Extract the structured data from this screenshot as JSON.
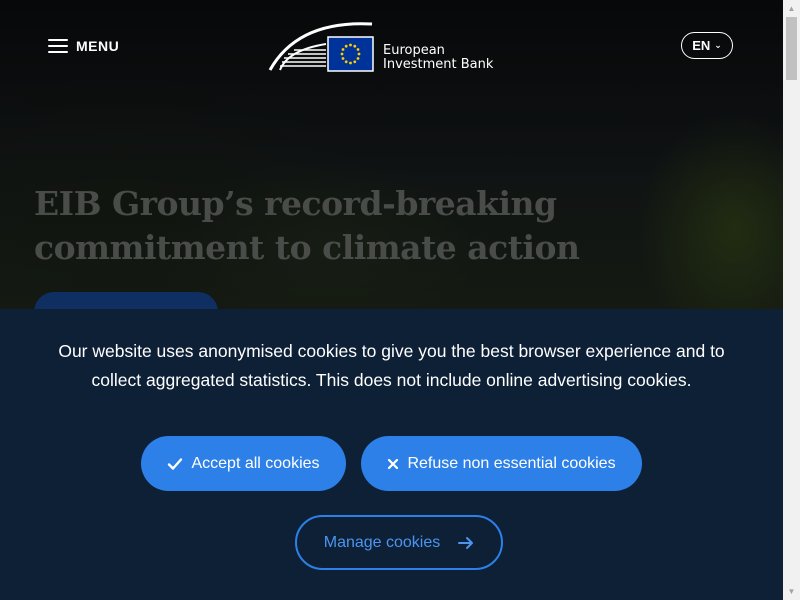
{
  "header": {
    "menu_label": "MENU",
    "logo_line1": "European",
    "logo_line2": "Investment Bank",
    "language": "EN",
    "icons": {
      "menu": "hamburger-icon",
      "lang": "chevron-down-icon"
    }
  },
  "hero": {
    "title": "EIB Group’s record-breaking commitment to climate action"
  },
  "cookie_banner": {
    "message": "Our website uses anonymised cookies to give you the best browser experience and to collect aggregated statistics. This does not include online advertising cookies.",
    "accept_label": "Accept all cookies",
    "refuse_label": "Refuse non essential cookies",
    "manage_label": "Manage cookies",
    "icons": {
      "accept": "checkmark-icon",
      "refuse": "x-icon",
      "manage": "arrow-right-icon"
    }
  },
  "colors": {
    "banner_bg": "#0e2036",
    "button_blue": "#2d80e8",
    "eu_flag_blue": "#003399",
    "eu_star_yellow": "#ffcc00"
  }
}
